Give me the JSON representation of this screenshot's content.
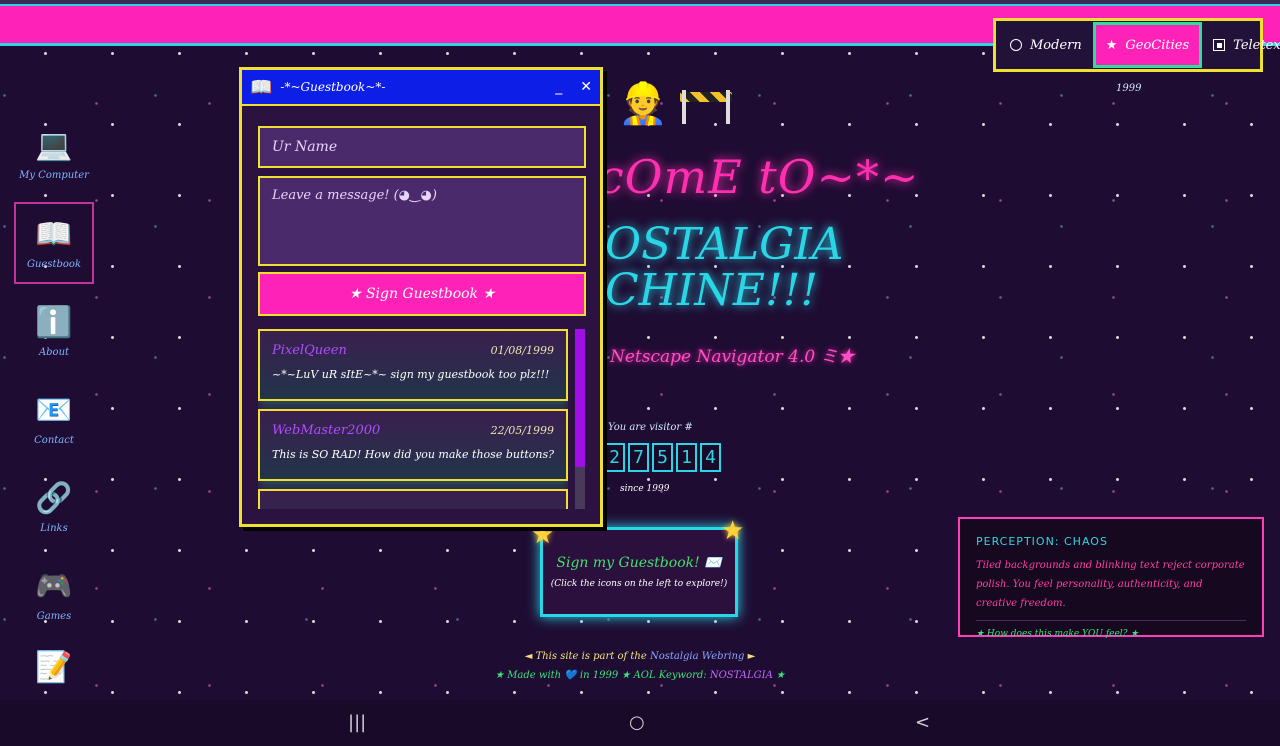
{
  "theme_switcher": {
    "options": [
      {
        "label": "Modern",
        "icon": "radio-empty-icon"
      },
      {
        "label": "GeoCities",
        "icon": "star-icon"
      },
      {
        "label": "Teletext",
        "icon": "square-dot-icon"
      }
    ],
    "selected": "GeoCities",
    "year": "1999"
  },
  "desktop_icons": [
    {
      "label": "My Computer",
      "glyph": "💻",
      "icon": "computer-icon"
    },
    {
      "label": "Guestbook",
      "glyph": "📖",
      "icon": "book-icon",
      "selected": true
    },
    {
      "label": "About",
      "glyph": "ℹ️",
      "icon": "info-icon"
    },
    {
      "label": "Contact",
      "glyph": "📧",
      "icon": "email-icon"
    },
    {
      "label": "Links",
      "glyph": "🔗",
      "icon": "link-icon"
    },
    {
      "label": "Games",
      "glyph": "🎮",
      "icon": "gamepad-icon"
    },
    {
      "label": "",
      "glyph": "📝",
      "icon": "notepad-icon"
    }
  ],
  "hero": {
    "worker_emoji": "👷",
    "welcome": "cOmE tO~*~",
    "title_line1": "OSTALGIA",
    "title_line2": "CHINE!!!",
    "subtitle": "Netscape Navigator 4.0 ミ★"
  },
  "counter": {
    "label": "You are visitor #",
    "digits": [
      "2",
      "7",
      "5",
      "1",
      "4"
    ],
    "since": "since 1999"
  },
  "cta": {
    "title": "Sign my Guestbook! ✉️",
    "subtitle": "(Click the icons on the left to explore!)",
    "star": "★"
  },
  "footer": {
    "line1_prefix": "◄ This site is part of the",
    "webring": "Nostalgia Webring",
    "line1_suffix": "►",
    "line2_prefix": "★ Made with 💙 in 1999 ★ AOL Keyword:",
    "keyword": "NOSTALGIA",
    "line2_suffix": "★"
  },
  "perception": {
    "heading": "PERCEPTION: CHAOS",
    "body": "Tiled backgrounds and blinking text reject corporate polish. You feel personality, authenticity, and creative freedom.",
    "question": "★ How does this make YOU feel? ★"
  },
  "guestbook": {
    "title": "-*~Guestbook~*-",
    "title_icon": "📖",
    "minimize": "_",
    "close": "✕",
    "name_placeholder": "Ur Name",
    "message_placeholder": "Leave a message! (◕‿◕)",
    "sign_label": "★ Sign Guestbook ★",
    "entries": [
      {
        "name": "PixelQueen",
        "date": "01/08/1999",
        "text": "~*~LuV uR sItE~*~ sign my guestbook too plz!!!"
      },
      {
        "name": "WebMaster2000",
        "date": "22/05/1999",
        "text": "This is SO RAD! How did you make those buttons?"
      },
      {
        "name": "",
        "date": "",
        "text": ""
      }
    ]
  },
  "android_nav": {
    "recents": "|||",
    "home": "○",
    "back": "<"
  },
  "colors": {
    "pink": "#ff22b8",
    "cyan": "#2ad6e6",
    "yellow": "#f0e030",
    "background": "#1f0c33"
  }
}
